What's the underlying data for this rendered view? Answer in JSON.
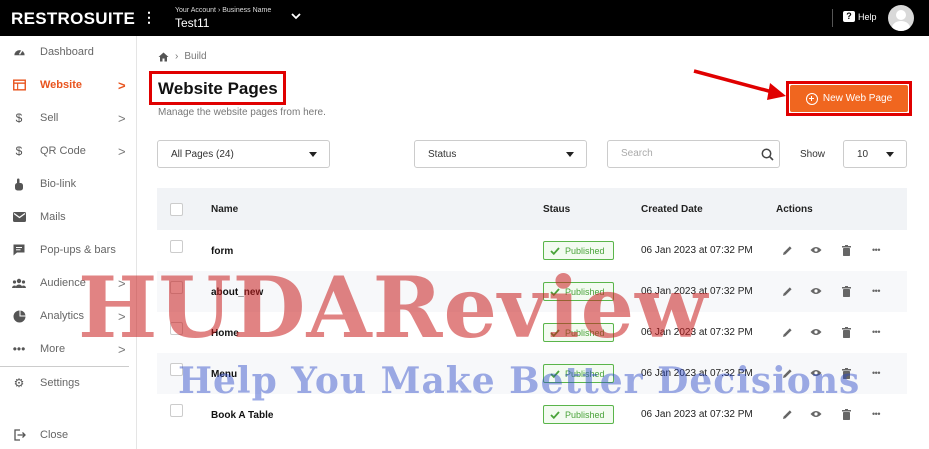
{
  "topbar": {
    "brand": "RESTROSUITE",
    "kebab": "⋮",
    "account_crumb": "Your Account › Business Name",
    "business_name": "Test11",
    "help_label": "Help"
  },
  "sidebar": {
    "items": [
      {
        "label": "Dashboard",
        "icon": "gauge-icon",
        "chevron": ""
      },
      {
        "label": "Website",
        "icon": "window-icon",
        "chevron": ">"
      },
      {
        "label": "Sell",
        "icon": "dollar-icon",
        "chevron": ">"
      },
      {
        "label": "QR Code",
        "icon": "dollar-icon",
        "chevron": ">"
      },
      {
        "label": "Bio-link",
        "icon": "hand-pointer-icon",
        "chevron": ""
      },
      {
        "label": "Mails",
        "icon": "envelope-icon",
        "chevron": ""
      },
      {
        "label": "Pop-ups & bars",
        "icon": "comment-icon",
        "chevron": ""
      },
      {
        "label": "Audience",
        "icon": "users-icon",
        "chevron": ">"
      },
      {
        "label": "Analytics",
        "icon": "pie-chart-icon",
        "chevron": ">"
      },
      {
        "label": "More",
        "icon": "dots-icon",
        "chevron": ">"
      },
      {
        "label": "Settings",
        "icon": "gear-icon",
        "chevron": ""
      },
      {
        "label": "Close",
        "icon": "sign-out-icon",
        "chevron": ""
      }
    ],
    "active_index": 1
  },
  "breadcrumb": {
    "current": "Build"
  },
  "page": {
    "title": "Website Pages",
    "subtitle": "Manage the website pages from here.",
    "new_button_label": "New Web Page"
  },
  "filters": {
    "pages_select": "All Pages (24)",
    "status_select": "Status",
    "search_placeholder": "Search",
    "show_label": "Show",
    "show_value": "10"
  },
  "table": {
    "columns": {
      "name": "Name",
      "status": "Staus",
      "created": "Created Date",
      "actions": "Actions"
    },
    "rows": [
      {
        "name": "form",
        "status": "Published",
        "created": "06 Jan 2023 at 07:32 PM"
      },
      {
        "name": "about_new",
        "status": "Published",
        "created": "06 Jan 2023 at 07:32 PM"
      },
      {
        "name": "Home",
        "status": "Published",
        "created": "06 Jan 2023 at 07:32 PM"
      },
      {
        "name": "Menu",
        "status": "Published",
        "created": "06 Jan 2023 at 07:32 PM"
      },
      {
        "name": "Book A Table",
        "status": "Published",
        "created": "06 Jan 2023 at 07:32 PM"
      }
    ]
  },
  "watermark": {
    "line1": "HUDAReview",
    "line2": "Help You Make Better Decisions"
  },
  "colors": {
    "accent": "#f0661f",
    "annotation_red": "#e00000",
    "published_green": "#4aa33a"
  }
}
